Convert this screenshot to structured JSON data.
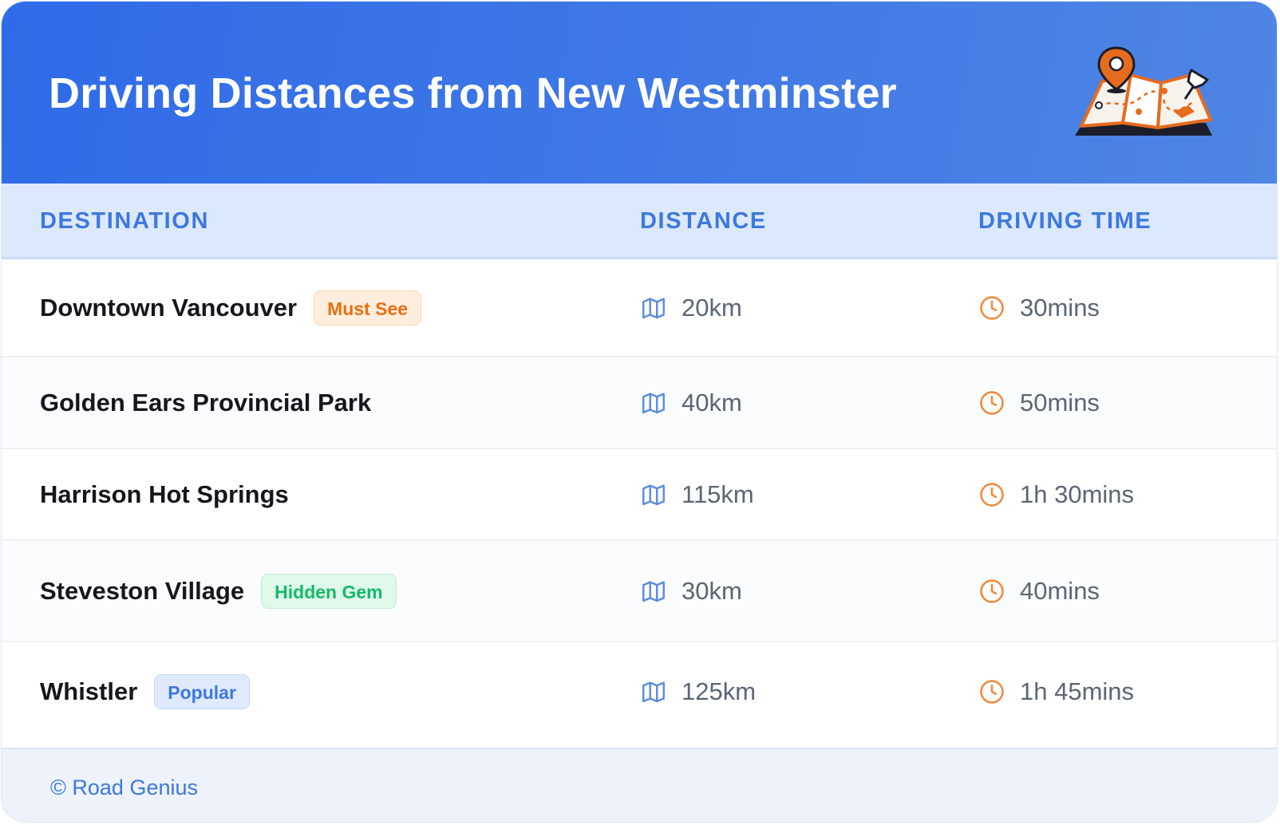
{
  "header": {
    "title": "Driving Distances from New Westminster",
    "illustration_icon": "folded-map-with-pin-icon"
  },
  "table": {
    "columns": [
      "DESTINATION",
      "DISTANCE",
      "DRIVING TIME"
    ],
    "rows": [
      {
        "destination": "Downtown Vancouver",
        "badge": "Must See",
        "badge_color": "#ec6f12",
        "distance": "20km",
        "time": "30mins"
      },
      {
        "destination": "Golden Ears Provincial Park",
        "badge": "",
        "distance": "40km",
        "time": "50mins"
      },
      {
        "destination": "Harrison Hot Springs",
        "badge": "",
        "distance": "115km",
        "time": "1h 30mins"
      },
      {
        "destination": "Steveston Village",
        "badge": "Hidden Gem",
        "badge_color": "#15b86a",
        "distance": "30km",
        "time": "40mins"
      },
      {
        "destination": "Whistler",
        "badge": "Popular",
        "badge_color": "#3d78de",
        "distance": "125km",
        "time": "1h 45mins"
      }
    ],
    "distance_icon": "map-icon",
    "time_icon": "clock-icon"
  },
  "footer": {
    "credit": "© Road Genius"
  },
  "colors": {
    "header_gradient_start": "#2f6be8",
    "header_gradient_end": "#4f86e4",
    "column_header_bg": "#dce9fd",
    "column_header_text": "#3d78de",
    "clock_icon": "#f08a3c",
    "map_icon": "#5a8bdd"
  }
}
